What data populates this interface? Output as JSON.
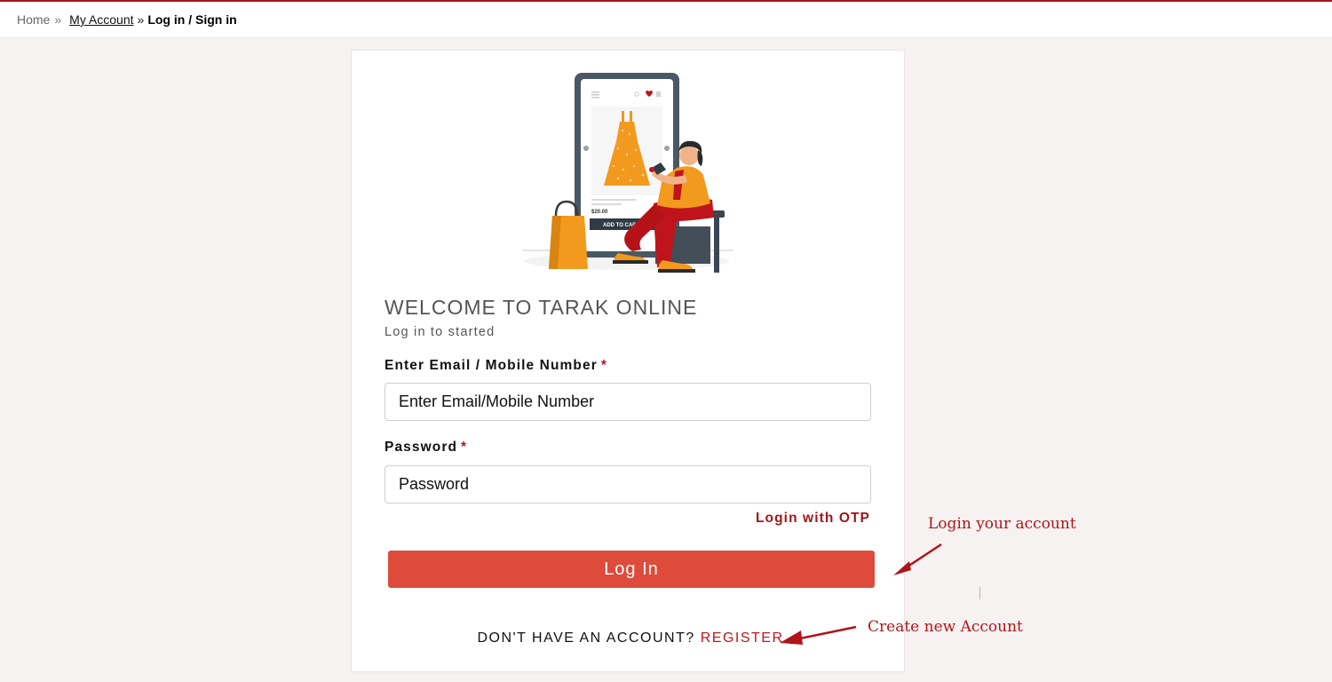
{
  "breadcrumb": {
    "home": "Home",
    "separator1": "»",
    "account": "My Account",
    "separator2": "»",
    "current": "Log in / Sign in"
  },
  "form": {
    "title": "WELCOME TO TARAK ONLINE",
    "subtitle": "Log in to started",
    "email_label": "Enter Email / Mobile Number",
    "email_placeholder": "Enter Email/Mobile Number",
    "password_label": "Password",
    "password_placeholder": "Password",
    "required_marker": "*",
    "otp_link": "Login with OTP",
    "login_button": "Log In",
    "no_account_text": "DON'T HAVE AN ACCOUNT?",
    "register_link": "REGISTER"
  },
  "illustration": {
    "price": "$20.00",
    "cart_button": "ADD TO CART"
  },
  "annotations": {
    "login_note": "Login your account",
    "register_note": "Create new Account"
  },
  "colors": {
    "accent_red": "#c0141c",
    "button_red": "#de4b3a",
    "annotation_red": "#b0141a",
    "page_bg": "#f7f2f2"
  }
}
